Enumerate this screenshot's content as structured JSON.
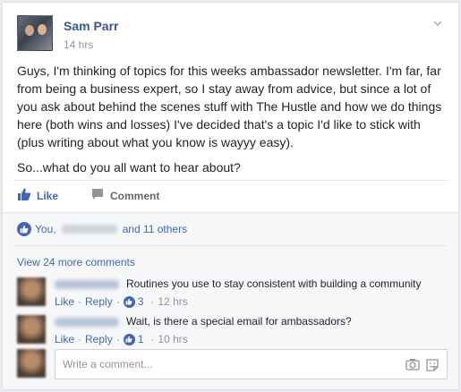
{
  "post": {
    "author": "Sam Parr",
    "time": "14 hrs",
    "paragraph1": "Guys, I'm thinking of topics for this weeks ambassador newsletter. I'm far, far from being a business expert, so I stay away from advice, but since a lot of you ask about behind the scenes stuff with The Hustle and how we do things here (both wins and losses) I've decided that's a topic I'd like to stick with (plus writing about what you know is wayyy easy).",
    "paragraph2": "So...what do you all want to hear about?"
  },
  "actions": {
    "like_label": "Like",
    "comment_label": "Comment"
  },
  "likes": {
    "you": "You,",
    "others": "and 11 others"
  },
  "comments": {
    "view_more": "View 24 more comments",
    "items": [
      {
        "text": "Routines you use to stay consistent with building a community",
        "like": "Like",
        "reply": "Reply",
        "count": "3",
        "time": "12 hrs"
      },
      {
        "text": "Wait, is there a special email for ambassadors?",
        "like": "Like",
        "reply": "Reply",
        "count": "1",
        "time": "10 hrs"
      }
    ],
    "write_placeholder": "Write a comment..."
  },
  "colors": {
    "link": "#4267b2",
    "name": "#365899",
    "muted": "#90949c",
    "background": "#e9ebee"
  },
  "icons": [
    "chevron-down-icon",
    "thumbs-up-icon",
    "comment-icon",
    "camera-icon",
    "sticker-icon"
  ]
}
